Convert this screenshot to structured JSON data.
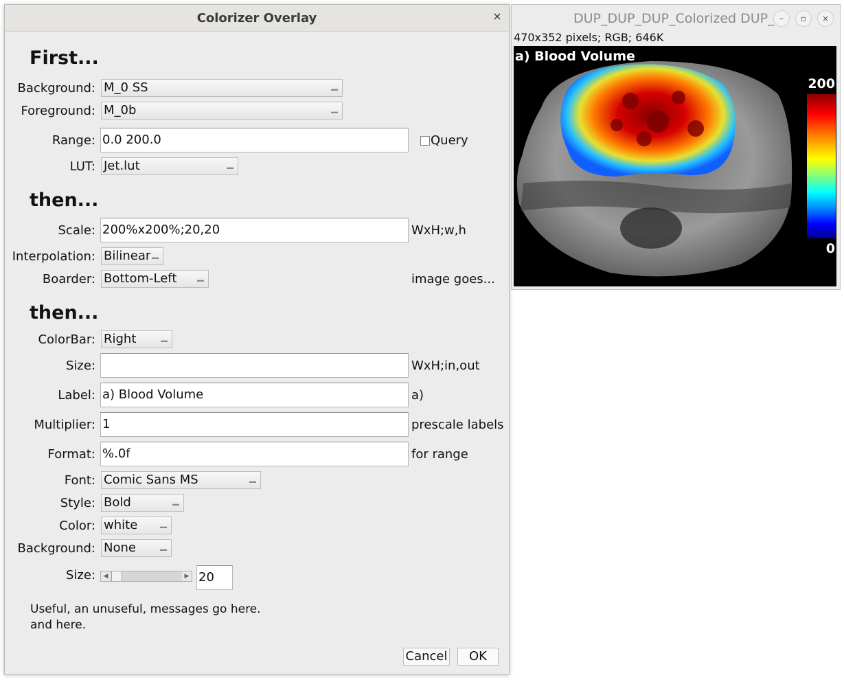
{
  "dialog": {
    "title": "Colorizer Overlay",
    "close_glyph": "×",
    "section1": {
      "heading": "First...",
      "background_label": "Background:",
      "background_value": "M_0 SS",
      "foreground_label": "Foreground:",
      "foreground_value": "M_0b",
      "range_label": "Range:",
      "range_value": "0.0 200.0",
      "query_label": "Query",
      "lut_label": "LUT:",
      "lut_value": "Jet.lut"
    },
    "section2": {
      "heading": "then...",
      "scale_label": "Scale:",
      "scale_value": "200%x200%;20,20",
      "scale_hint": "WxH;w,h",
      "interp_label": "Interpolation:",
      "interp_value": "Bilinear",
      "boarder_label": "Boarder:",
      "boarder_value": "Bottom-Left",
      "boarder_hint": "image goes..."
    },
    "section3": {
      "heading": "then...",
      "colorbar_label": "ColorBar:",
      "colorbar_value": "Right",
      "size_label": "Size:",
      "size_value": "",
      "size_hint": "WxH;in,out",
      "label_label": "Label:",
      "label_value": "a) Blood Volume",
      "label_hint": "a)",
      "multiplier_label": "Multiplier:",
      "multiplier_value": "1",
      "multiplier_hint": "prescale labels",
      "format_label": "Format:",
      "format_value": "%.0f",
      "format_hint": "for range",
      "font_label": "Font:",
      "font_value": "Comic Sans MS",
      "style_label": "Style:",
      "style_value": "Bold",
      "color_label": "Color:",
      "color_value": "white",
      "bg_label": "Background:",
      "bg_value": "None",
      "fontsize_label": "Size:",
      "fontsize_value": "20"
    },
    "messages": {
      "line1": "Useful, an unuseful, messages go here.",
      "line2": "and here."
    },
    "buttons": {
      "cancel": "Cancel",
      "ok": "OK"
    }
  },
  "image_window": {
    "title": "DUP_DUP_DUP_Colorized DUP_",
    "info": "470x352 pixels; RGB; 646K",
    "overlay_label": "a) Blood Volume",
    "colorbar_max": "200",
    "colorbar_min": "0"
  }
}
